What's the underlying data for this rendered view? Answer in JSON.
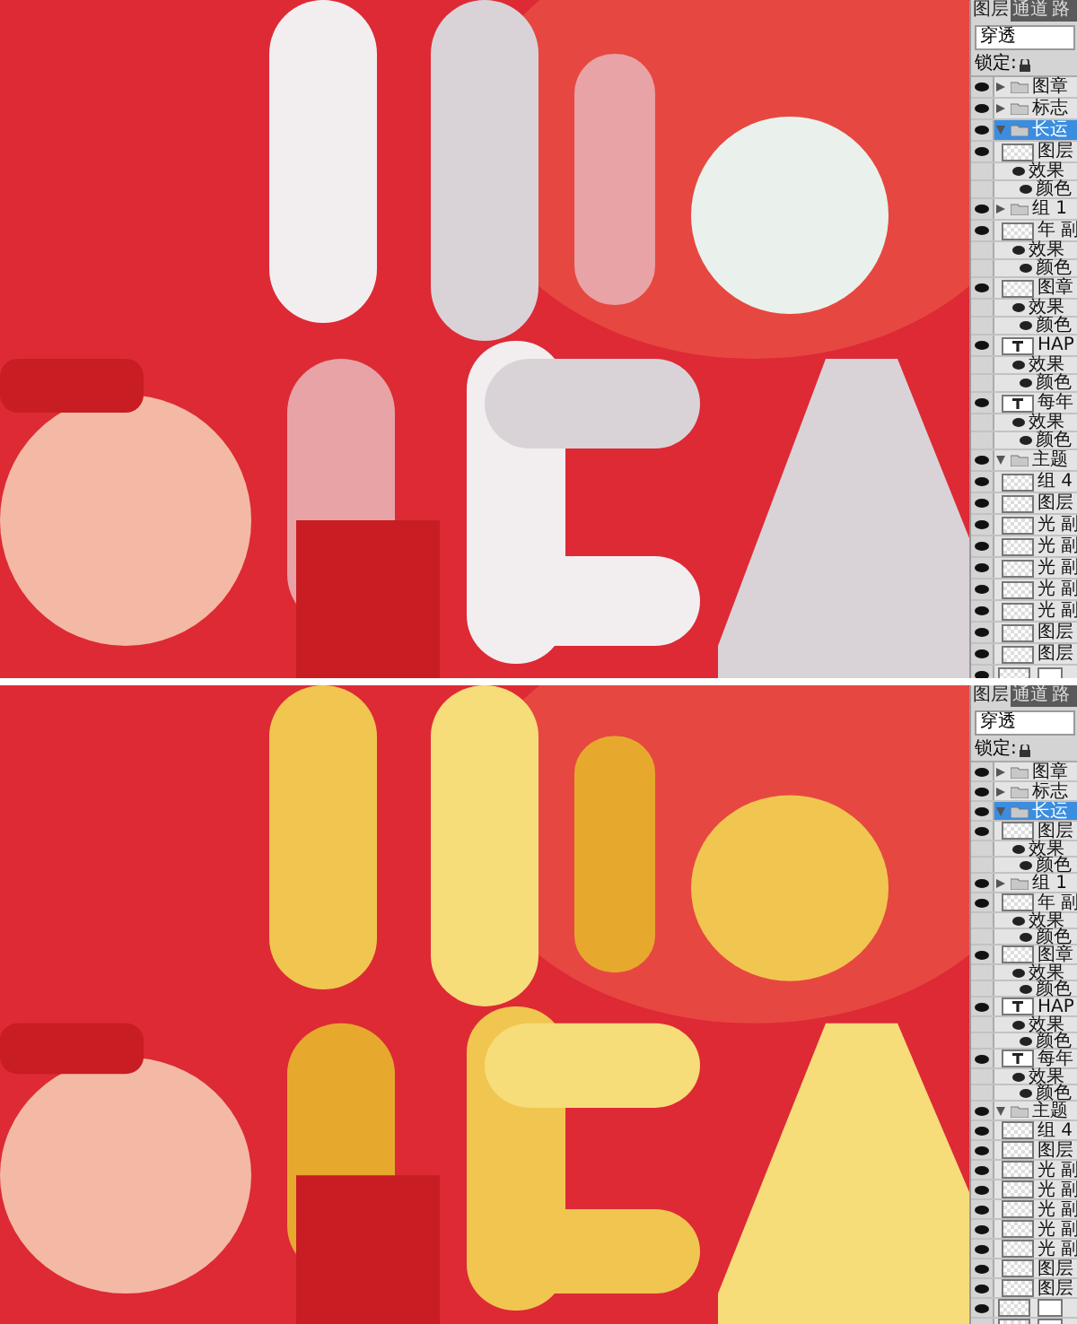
{
  "panes": [
    {
      "layers_panel": {
        "tabs": [
          {
            "label": "图层",
            "selected": true
          },
          {
            "label": "通道",
            "selected": false
          },
          {
            "label": "路",
            "selected": false
          }
        ],
        "blend_mode": "穿透",
        "lock_label": "锁定:",
        "layers": [
          {
            "kind": "group",
            "name": "图章",
            "expanded": false,
            "selected": false
          },
          {
            "kind": "group",
            "name": "标志",
            "expanded": false,
            "selected": false
          },
          {
            "kind": "group",
            "name": "长运",
            "expanded": true,
            "selected": true
          },
          {
            "kind": "layer",
            "name": "图层",
            "selected": false
          },
          {
            "kind": "effect",
            "name": "效果",
            "selected": false
          },
          {
            "kind": "style",
            "name": "颜色",
            "selected": false
          },
          {
            "kind": "group",
            "name": "组 1",
            "expanded": false,
            "selected": false
          },
          {
            "kind": "layer",
            "name": "年 副",
            "selected": false
          },
          {
            "kind": "effect",
            "name": "效果",
            "selected": false
          },
          {
            "kind": "style",
            "name": "颜色",
            "selected": false
          },
          {
            "kind": "layer",
            "name": "图章",
            "selected": false
          },
          {
            "kind": "effect",
            "name": "效果",
            "selected": false
          },
          {
            "kind": "style",
            "name": "颜色",
            "selected": false
          },
          {
            "kind": "text",
            "name": "HAP",
            "selected": false
          },
          {
            "kind": "effect",
            "name": "效果",
            "selected": false
          },
          {
            "kind": "style",
            "name": "颜色",
            "selected": false
          },
          {
            "kind": "text",
            "name": "每年",
            "selected": false
          },
          {
            "kind": "effect",
            "name": "效果",
            "selected": false
          },
          {
            "kind": "style",
            "name": "颜色",
            "selected": false
          },
          {
            "kind": "group",
            "name": "主题",
            "expanded": true,
            "selected": false
          },
          {
            "kind": "layer",
            "name": "组 4",
            "selected": false
          },
          {
            "kind": "layer",
            "name": "图层",
            "selected": false
          },
          {
            "kind": "layer",
            "name": "光 副",
            "selected": false
          },
          {
            "kind": "layer",
            "name": "光 副",
            "selected": false
          },
          {
            "kind": "layer",
            "name": "光 副",
            "selected": false
          },
          {
            "kind": "layer",
            "name": "光 副",
            "selected": false
          },
          {
            "kind": "layer",
            "name": "光 副",
            "selected": false
          },
          {
            "kind": "layer",
            "name": "图层",
            "selected": false
          },
          {
            "kind": "layer",
            "name": "图层",
            "selected": false
          },
          {
            "kind": "masked",
            "selected": false
          }
        ]
      }
    },
    {
      "layers_panel": {
        "tabs": [
          {
            "label": "图层",
            "selected": true
          },
          {
            "label": "通道",
            "selected": false
          },
          {
            "label": "路",
            "selected": false
          }
        ],
        "blend_mode": "穿透",
        "lock_label": "锁定:",
        "layers": [
          {
            "kind": "group",
            "name": "图章",
            "expanded": false,
            "selected": false
          },
          {
            "kind": "group",
            "name": "标志",
            "expanded": false,
            "selected": false
          },
          {
            "kind": "group",
            "name": "长运",
            "expanded": true,
            "selected": true
          },
          {
            "kind": "layer",
            "name": "图层",
            "selected": false
          },
          {
            "kind": "effect",
            "name": "效果",
            "selected": false
          },
          {
            "kind": "style",
            "name": "颜色",
            "selected": false
          },
          {
            "kind": "group",
            "name": "组 1",
            "expanded": false,
            "selected": false
          },
          {
            "kind": "layer",
            "name": "年 副",
            "selected": false
          },
          {
            "kind": "effect",
            "name": "效果",
            "selected": false
          },
          {
            "kind": "style",
            "name": "颜色",
            "selected": false
          },
          {
            "kind": "layer",
            "name": "图章",
            "selected": false
          },
          {
            "kind": "effect",
            "name": "效果",
            "selected": false
          },
          {
            "kind": "style",
            "name": "颜色",
            "selected": false
          },
          {
            "kind": "text",
            "name": "HAP",
            "selected": false
          },
          {
            "kind": "effect",
            "name": "效果",
            "selected": false
          },
          {
            "kind": "style",
            "name": "颜色",
            "selected": false
          },
          {
            "kind": "text",
            "name": "每年",
            "selected": false
          },
          {
            "kind": "effect",
            "name": "效果",
            "selected": false
          },
          {
            "kind": "style",
            "name": "颜色",
            "selected": false
          },
          {
            "kind": "group",
            "name": "主题",
            "expanded": true,
            "selected": false
          },
          {
            "kind": "layer",
            "name": "组 4",
            "selected": false
          },
          {
            "kind": "layer",
            "name": "图层",
            "selected": false
          },
          {
            "kind": "layer",
            "name": "光 副",
            "selected": false
          },
          {
            "kind": "layer",
            "name": "光 副",
            "selected": false
          },
          {
            "kind": "layer",
            "name": "光 副",
            "selected": false
          },
          {
            "kind": "layer",
            "name": "光 副",
            "selected": false
          },
          {
            "kind": "layer",
            "name": "光 副",
            "selected": false
          },
          {
            "kind": "layer",
            "name": "图层",
            "selected": false
          },
          {
            "kind": "layer",
            "name": "图层",
            "selected": false
          },
          {
            "kind": "masked",
            "selected": false
          },
          {
            "kind": "masked",
            "selected": false
          }
        ]
      }
    }
  ]
}
